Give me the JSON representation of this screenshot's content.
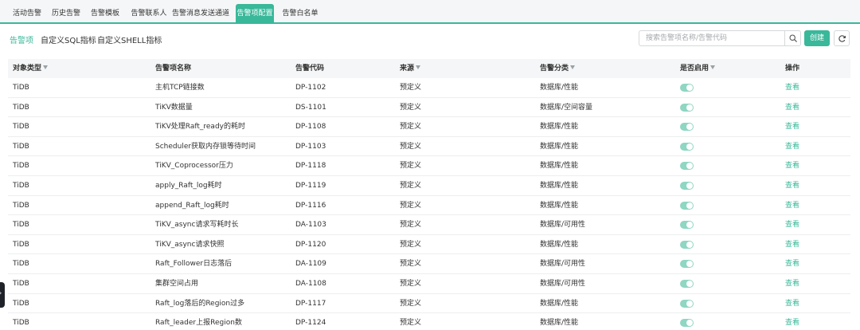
{
  "tabs": [
    "活动告警",
    "历史告警",
    "告警模板",
    "告警联系人",
    "告警消息发送通道",
    "告警项配置",
    "告警白名单"
  ],
  "active_tab_index": 5,
  "subtabs": [
    "告警项",
    "自定义SQL指标",
    "自定义SHELL指标"
  ],
  "active_subtab_index": 0,
  "search": {
    "placeholder": "搜索告警项名称/告警代码"
  },
  "create_label": "创建",
  "columns": {
    "type": "对象类型",
    "name": "告警项名称",
    "code": "告警代码",
    "source": "来源",
    "category": "告警分类",
    "enabled": "是否启用",
    "ops": "操作"
  },
  "rows": [
    {
      "type": "TiDB",
      "name": "主机TCP链接数",
      "code": "DP-1102",
      "source": "预定义",
      "category": "数据库/性能",
      "enabled": true,
      "action": "查看"
    },
    {
      "type": "TiDB",
      "name": "TiKV数据量",
      "code": "DS-1101",
      "source": "预定义",
      "category": "数据库/空间容量",
      "enabled": true,
      "action": "查看"
    },
    {
      "type": "TiDB",
      "name": "TiKV处理Raft_ready的耗时",
      "code": "DP-1108",
      "source": "预定义",
      "category": "数据库/性能",
      "enabled": true,
      "action": "查看"
    },
    {
      "type": "TiDB",
      "name": "Scheduler获取内存锁等待时间",
      "code": "DP-1103",
      "source": "预定义",
      "category": "数据库/性能",
      "enabled": true,
      "action": "查看"
    },
    {
      "type": "TiDB",
      "name": "TiKV_Coprocessor压力",
      "code": "DP-1118",
      "source": "预定义",
      "category": "数据库/性能",
      "enabled": true,
      "action": "查看"
    },
    {
      "type": "TiDB",
      "name": "apply_Raft_log耗时",
      "code": "DP-1119",
      "source": "预定义",
      "category": "数据库/性能",
      "enabled": true,
      "action": "查看"
    },
    {
      "type": "TiDB",
      "name": "append_Raft_log耗时",
      "code": "DP-1116",
      "source": "预定义",
      "category": "数据库/性能",
      "enabled": true,
      "action": "查看"
    },
    {
      "type": "TiDB",
      "name": "TiKV_async请求写耗时长",
      "code": "DA-1103",
      "source": "预定义",
      "category": "数据库/可用性",
      "enabled": true,
      "action": "查看"
    },
    {
      "type": "TiDB",
      "name": "TiKV_async请求快照",
      "code": "DP-1120",
      "source": "预定义",
      "category": "数据库/性能",
      "enabled": true,
      "action": "查看"
    },
    {
      "type": "TiDB",
      "name": "Raft_Follower日志落后",
      "code": "DA-1109",
      "source": "预定义",
      "category": "数据库/可用性",
      "enabled": true,
      "action": "查看"
    },
    {
      "type": "TiDB",
      "name": "集群空间占用",
      "code": "DA-1108",
      "source": "预定义",
      "category": "数据库/可用性",
      "enabled": true,
      "action": "查看"
    },
    {
      "type": "TiDB",
      "name": "Raft_log落后的Region过多",
      "code": "DP-1117",
      "source": "预定义",
      "category": "数据库/性能",
      "enabled": true,
      "action": "查看"
    },
    {
      "type": "TiDB",
      "name": "Raft_leader上报Region数",
      "code": "DP-1124",
      "source": "预定义",
      "category": "数据库/性能",
      "enabled": true,
      "action": "查看"
    }
  ],
  "colors": {
    "accent": "#39b89a",
    "toggle_on": "#8fd6c3"
  },
  "icons": {
    "search": "search-icon",
    "refresh": "refresh-icon",
    "filter": "filter-icon",
    "side_handle": "chevron-right-icon"
  }
}
